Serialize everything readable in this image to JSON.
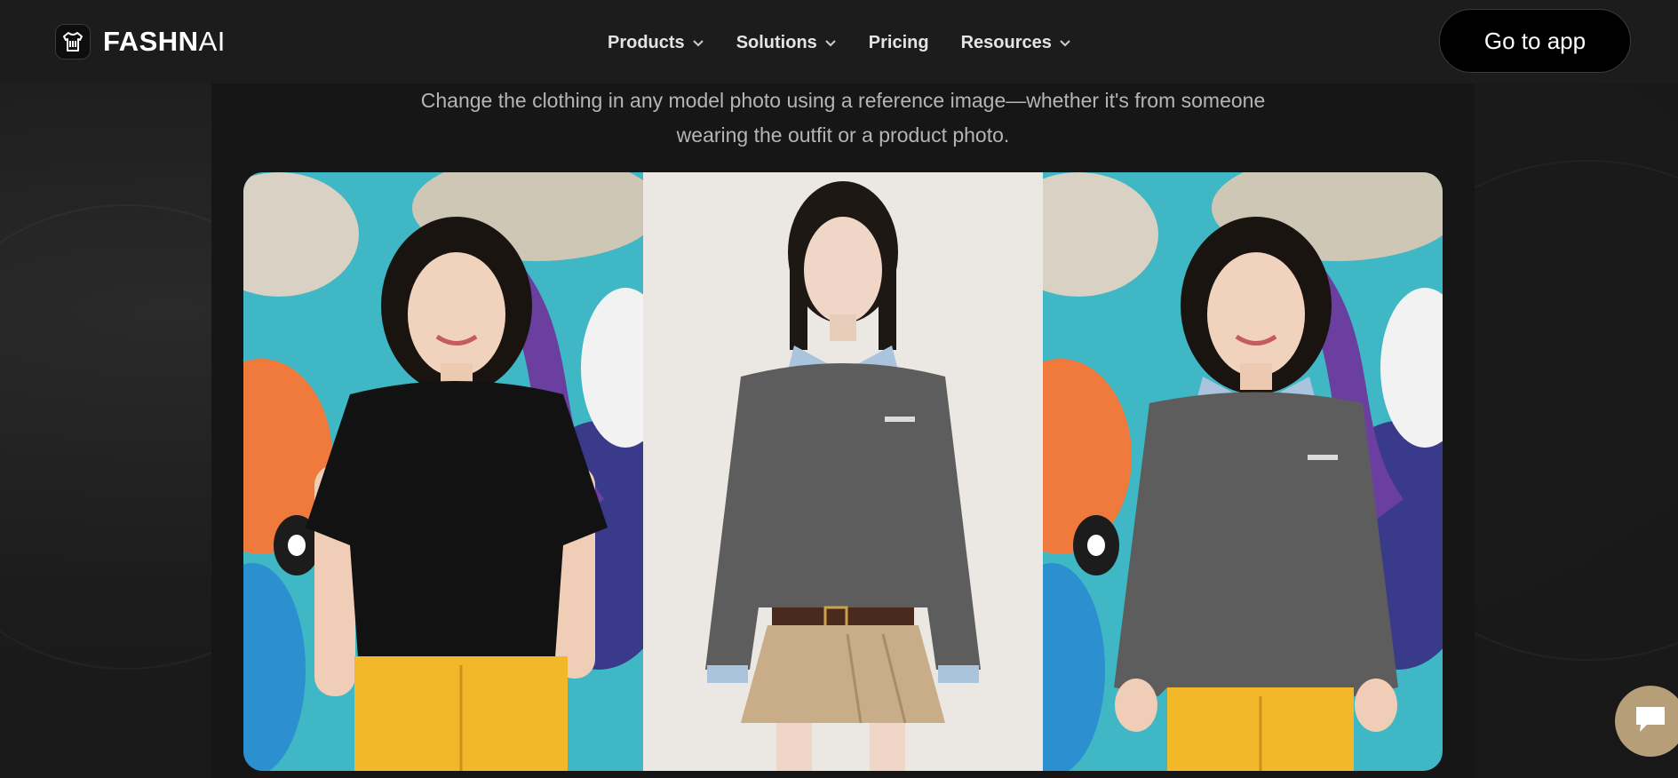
{
  "header": {
    "brand_bold": "FASHN",
    "brand_thin": "AI",
    "nav": [
      {
        "label": "Products",
        "dropdown": true
      },
      {
        "label": "Solutions",
        "dropdown": true
      },
      {
        "label": "Pricing",
        "dropdown": false
      },
      {
        "label": "Resources",
        "dropdown": true
      }
    ],
    "cta_label": "Go to app"
  },
  "hero": {
    "subtitle_line1": "Change the clothing in any model photo using a reference image—whether it's from someone",
    "subtitle_line2": "wearing the outfit or a product photo."
  },
  "gallery": {
    "panels": [
      {
        "name": "model-photo",
        "icon": "photo"
      },
      {
        "name": "reference-garment-photo",
        "icon": "photo"
      },
      {
        "name": "result-photo",
        "icon": "photo"
      }
    ]
  },
  "colors": {
    "background": "#1a1a1a",
    "card": "#161616",
    "cta_bg": "#000000",
    "chat_bubble": "#b59e78",
    "subtitle": "#b5b5b5"
  },
  "icons": {
    "logo": "shirt-logo-icon",
    "chevron": "chevron-down-icon",
    "chat": "chat-bubble-icon"
  }
}
